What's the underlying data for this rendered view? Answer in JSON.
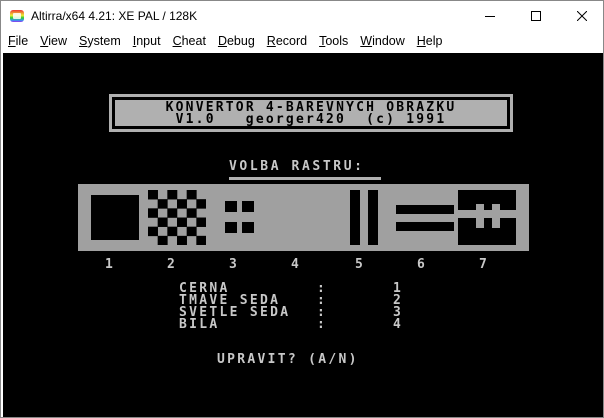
{
  "window": {
    "title": "Altirra/x64 4.21: XE PAL / 128K",
    "controls": [
      "minimize",
      "maximize",
      "close"
    ]
  },
  "menu": [
    {
      "label": "File",
      "mnemonic": "F",
      "rest": "ile"
    },
    {
      "label": "View",
      "mnemonic": "V",
      "rest": "iew"
    },
    {
      "label": "System",
      "mnemonic": "S",
      "rest": "ystem"
    },
    {
      "label": "Input",
      "mnemonic": "I",
      "rest": "nput"
    },
    {
      "label": "Cheat",
      "mnemonic": "C",
      "rest": "heat"
    },
    {
      "label": "Debug",
      "mnemonic": "D",
      "rest": "ebug"
    },
    {
      "label": "Record",
      "mnemonic": "R",
      "rest": "ecord"
    },
    {
      "label": "Tools",
      "mnemonic": "T",
      "rest": "ools"
    },
    {
      "label": "Window",
      "mnemonic": "W",
      "rest": "indow"
    },
    {
      "label": "Help",
      "mnemonic": "H",
      "rest": "elp"
    }
  ],
  "screen": {
    "header_line1": "KONVERTOR 4-BAREVNYCH OBRAZKU",
    "header_line2": "V1.0   georger420  (c) 1991",
    "volba": "VOLBA RASTRU:",
    "pattern_numbers": [
      "1",
      "2",
      "3",
      "4",
      "5",
      "6",
      "7"
    ],
    "colors": [
      {
        "name": "CERNA",
        "sep": ":",
        "value": "1"
      },
      {
        "name": "TMAVE SEDA",
        "sep": ":",
        "value": "2"
      },
      {
        "name": "SVETLE SEDA",
        "sep": ":",
        "value": "3"
      },
      {
        "name": "BILA",
        "sep": ":",
        "value": "4"
      }
    ],
    "prompt": "UPRAVIT? (A/N)",
    "palette": {
      "background": "#000000",
      "gray": "#a0a0a0",
      "light": "#c8c8c8"
    }
  }
}
